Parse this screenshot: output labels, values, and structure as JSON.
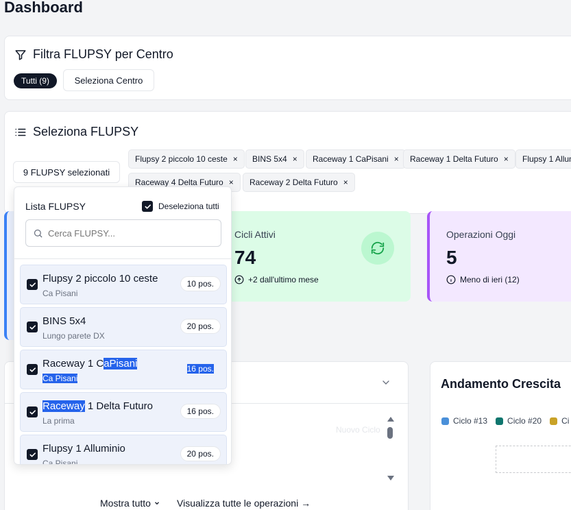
{
  "page": {
    "title": "Dashboard"
  },
  "filter": {
    "title": "Filtra FLUPSY per Centro",
    "all_label": "Tutti (9)",
    "select_center_label": "Seleziona Centro"
  },
  "selector": {
    "title": "Seleziona FLUPSY",
    "count_button": "9 FLUPSY selezionati",
    "chips": [
      {
        "label": "Flupsy 2 piccolo 10 ceste"
      },
      {
        "label": "BINS 5x4"
      },
      {
        "label": "Raceway 1 CaPisani"
      },
      {
        "label": "Raceway 1 Delta Futuro"
      },
      {
        "label": "Flupsy 1 Allum"
      },
      {
        "label": "Raceway 4 Delta Futuro"
      },
      {
        "label": "Raceway 2 Delta Futuro"
      }
    ],
    "remove_symbol": "×"
  },
  "dropdown": {
    "title": "Lista FLUPSY",
    "deselect_label": "Deseleziona tutti",
    "search_placeholder": "Cerca FLUPSY...",
    "items": [
      {
        "name": "Flupsy 2 piccolo 10 ceste",
        "sub": "Ca Pisani",
        "badge": "10 pos."
      },
      {
        "name": "BINS 5x4",
        "sub": "Lungo parete DX",
        "badge": "20 pos."
      },
      {
        "name_a": "Raceway 1 C",
        "name_b": "aPisani",
        "sub": "Ca Pisani",
        "badge": "16 pos."
      },
      {
        "name_a": "Raceway",
        "name_b": " 1 Delta Futuro",
        "sub": "La prima",
        "badge": "16 pos."
      },
      {
        "name": "Flupsy 1 Alluminio",
        "sub": "Ca Pisani",
        "badge": "20 pos."
      }
    ]
  },
  "stats": [
    {
      "label": "Cicli Attivi",
      "value": "74",
      "sub": "+2 dall'ultimo mese"
    },
    {
      "label": "Operazioni Oggi",
      "value": "5",
      "sub": "Meno di ieri (12)"
    }
  ],
  "operations": {
    "faded_label": "Nuovo Ciclo",
    "show_all": "Mostra tutto",
    "view_all": "Visualizza tutte le operazioni →"
  },
  "growth": {
    "title": "Andamento Crescita",
    "legend": [
      {
        "label": "Ciclo #13",
        "color": "#4a90d9"
      },
      {
        "label": "Ciclo #20",
        "color": "#0f766e"
      },
      {
        "label": "Ci",
        "color": "#c9a227"
      }
    ]
  }
}
